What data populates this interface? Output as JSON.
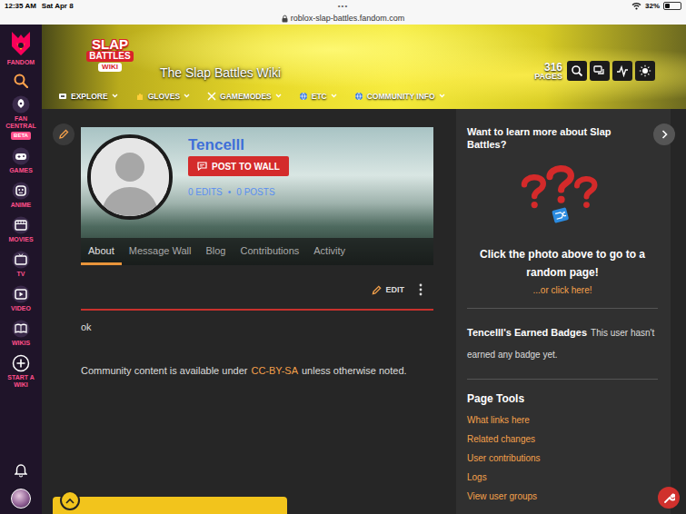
{
  "status_bar": {
    "time": "12:35 AM",
    "date": "Sat Apr 8",
    "dots": "•••",
    "url": "roblox-slap-battles.fandom.com",
    "battery": "32%",
    "battery_level": 0.32
  },
  "fandom_nav": {
    "logo_label": "FANDOM",
    "items": [
      {
        "label": "FAN CENTRAL",
        "badge": "BETA"
      },
      {
        "label": "GAMES"
      },
      {
        "label": "ANIME"
      },
      {
        "label": "MOVIES"
      },
      {
        "label": "TV"
      },
      {
        "label": "VIDEO"
      },
      {
        "label": "WIKIS"
      },
      {
        "label": "START A WIKI"
      }
    ]
  },
  "wiki_header": {
    "logo": [
      "SLAP",
      "BATTLES",
      "WIKI"
    ],
    "title": "The Slap Battles Wiki",
    "page_count": "316",
    "page_count_label": "PAGES",
    "nav": [
      "EXPLORE",
      "GLOVES",
      "GAMEMODES",
      "ETC",
      "COMMUNITY INFO"
    ]
  },
  "profile": {
    "username": "Tencelll",
    "post_button": "POST TO WALL",
    "edits": "0 EDITS",
    "separator": "•",
    "posts": "0 POSTS",
    "tabs": [
      {
        "label": "About",
        "selected": true
      },
      {
        "label": "Message Wall",
        "selected": false
      },
      {
        "label": "Blog",
        "selected": false
      },
      {
        "label": "Contributions",
        "selected": false
      },
      {
        "label": "Activity",
        "selected": false
      }
    ]
  },
  "content": {
    "edit_button": "EDIT",
    "body": "ok",
    "license_prefix": "Community content is available under",
    "license_link": "CC-BY-SA",
    "license_suffix": "unless otherwise noted."
  },
  "rail": {
    "promo_title": "Want to learn more about Slap Battles?",
    "promo_caption": "Click the photo above to go to a random page!",
    "promo_link": "...or click here!",
    "badges_title": "Tencelll's Earned Badges",
    "badges_text": "This user hasn't earned any badge yet.",
    "tools_title": "Page Tools",
    "tools": [
      "What links here",
      "Related changes",
      "User contributions",
      "Logs",
      "View user groups"
    ]
  }
}
